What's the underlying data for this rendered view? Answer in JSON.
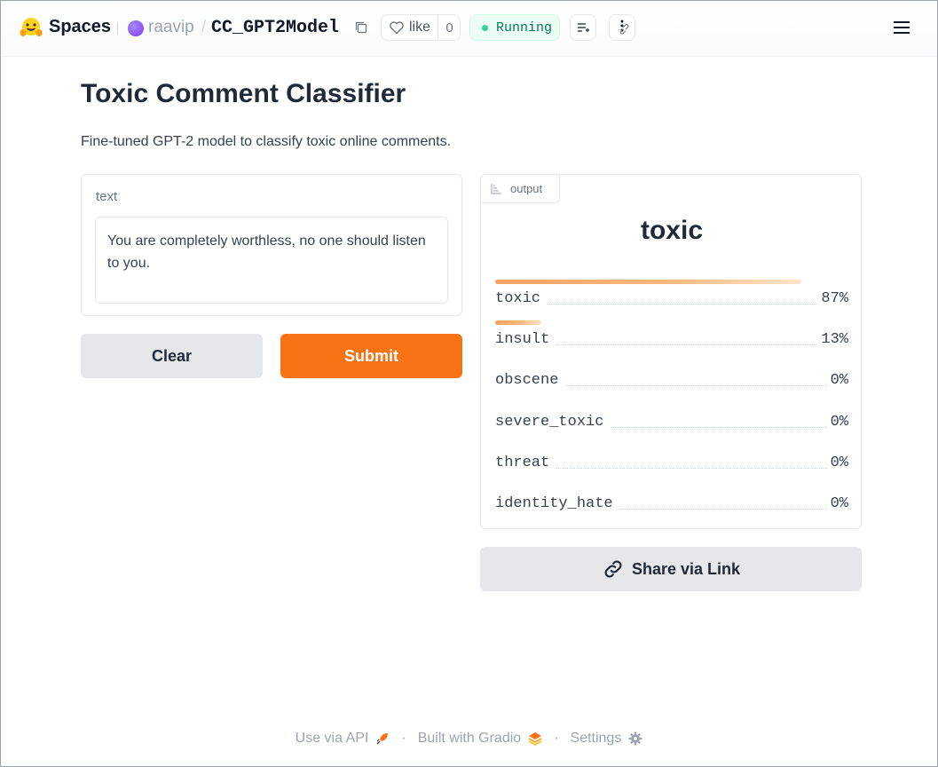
{
  "header": {
    "brand": "Spaces",
    "owner": "raavip",
    "separator": "/",
    "repo": "CC_GPT2Model",
    "like_label": "like",
    "like_count": "0",
    "status": "Running",
    "icons": [
      "huggingface-logo",
      "copy-icon",
      "heart-icon",
      "list-icon",
      "more-vertical-icon",
      "hamburger-menu-icon"
    ]
  },
  "page": {
    "title": "Toxic Comment Classifier",
    "description": "Fine-tuned GPT-2 model to classify toxic online comments."
  },
  "input": {
    "label": "text",
    "value": "You are completely worthless, no one should listen to you."
  },
  "buttons": {
    "clear": "Clear",
    "submit": "Submit",
    "share": "Share via Link"
  },
  "output": {
    "tab_label": "output",
    "top_label": "toxic",
    "rows": [
      {
        "label": "toxic",
        "pct": "87%",
        "value": 0.87
      },
      {
        "label": "insult",
        "pct": "13%",
        "value": 0.13
      },
      {
        "label": "obscene",
        "pct": "0%",
        "value": 0
      },
      {
        "label": "severe_toxic",
        "pct": "0%",
        "value": 0
      },
      {
        "label": "threat",
        "pct": "0%",
        "value": 0
      },
      {
        "label": "identity_hate",
        "pct": "0%",
        "value": 0
      }
    ]
  },
  "footer": {
    "api": "Use via API",
    "built": "Built with Gradio",
    "settings": "Settings",
    "dot": "·"
  },
  "colors": {
    "accent": "#f97316",
    "status_green": "#34d399"
  }
}
